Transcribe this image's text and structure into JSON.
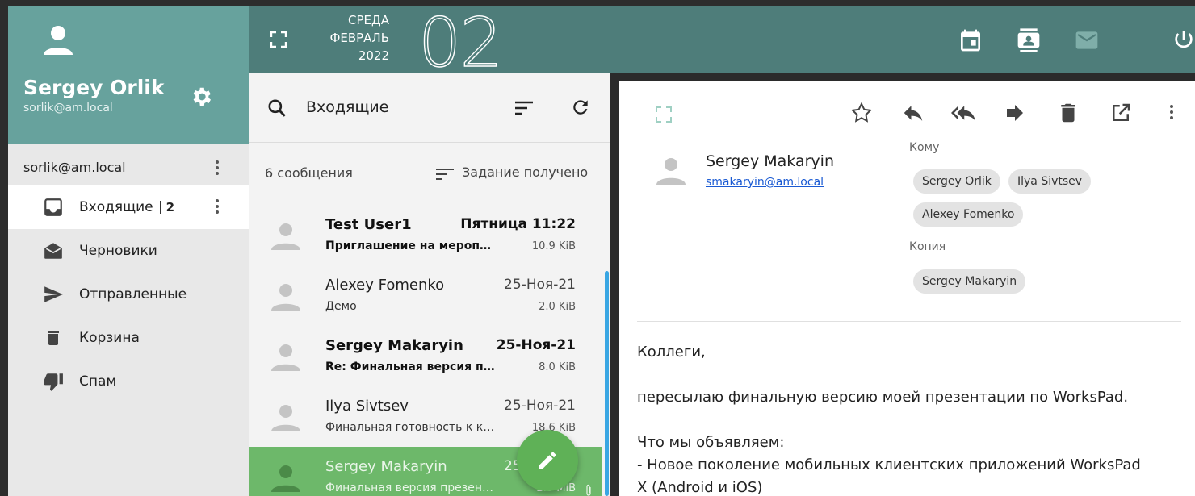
{
  "user": {
    "name": "Sergey Orlik",
    "email": "sorlik@am.local"
  },
  "account": {
    "label": "sorlik@am.local"
  },
  "folders": [
    {
      "label": "Входящие",
      "count": "2",
      "icon": "inbox-icon"
    },
    {
      "label": "Черновики",
      "icon": "drafts-icon"
    },
    {
      "label": "Отправленные",
      "icon": "send-icon"
    },
    {
      "label": "Корзина",
      "icon": "trash-icon"
    },
    {
      "label": "Спам",
      "icon": "thumb-down-icon"
    }
  ],
  "header": {
    "weekday": "СРЕДА",
    "month": "ФЕВРАЛЬ",
    "year": "2022",
    "day": "02"
  },
  "list": {
    "title": "Входящие",
    "count_text": "6 сообщения",
    "sort_label": "Задание получено",
    "messages": [
      {
        "sender": "Test User1",
        "date": "Пятница 11:22",
        "subject": "Приглашение на мероприятие",
        "size": "10.9 KiB",
        "unread": true
      },
      {
        "sender": "Alexey Fomenko",
        "date": "25-Ноя-21",
        "subject": "Демо",
        "size": "2.0 KiB",
        "unread": false
      },
      {
        "sender": "Sergey Makaryin",
        "date": "25-Ноя-21",
        "subject": "Re: Финальная версия презентации",
        "size": "8.0 KiB",
        "unread": true
      },
      {
        "sender": "Ilya Sivtsev",
        "date": "25-Ноя-21",
        "subject": "Финальная готовность к конференции",
        "size": "18.6 KiB",
        "unread": false
      },
      {
        "sender": "Sergey Makaryin",
        "date": "25-Ноя-21",
        "subject": "Финальная версия презентации",
        "size": "2.5 MiB",
        "unread": false,
        "selected": true
      }
    ]
  },
  "reading": {
    "sender": "Sergey Makaryin",
    "email": "smakaryin@am.local",
    "to_label": "Кому",
    "to": [
      "Sergey Orlik",
      "Ilya Sivtsev",
      "Alexey Fomenko"
    ],
    "cc_label": "Копия",
    "cc": [
      "Sergey Makaryin"
    ],
    "body": {
      "line1": "Коллеги,",
      "line2": "пересылаю финальную версию моей презентации по WorksPad.",
      "line3": "Что мы объявляем:",
      "line4": "- Новое поколение мобильных клиентских приложений WorksPad",
      "line5": "X (Android и iOS)"
    }
  },
  "colors": {
    "profile": "#67a29d",
    "topbar": "#4e7d7a",
    "selected": "#6db86a",
    "fab": "#5fb157",
    "scroll": "#39a6e3"
  }
}
